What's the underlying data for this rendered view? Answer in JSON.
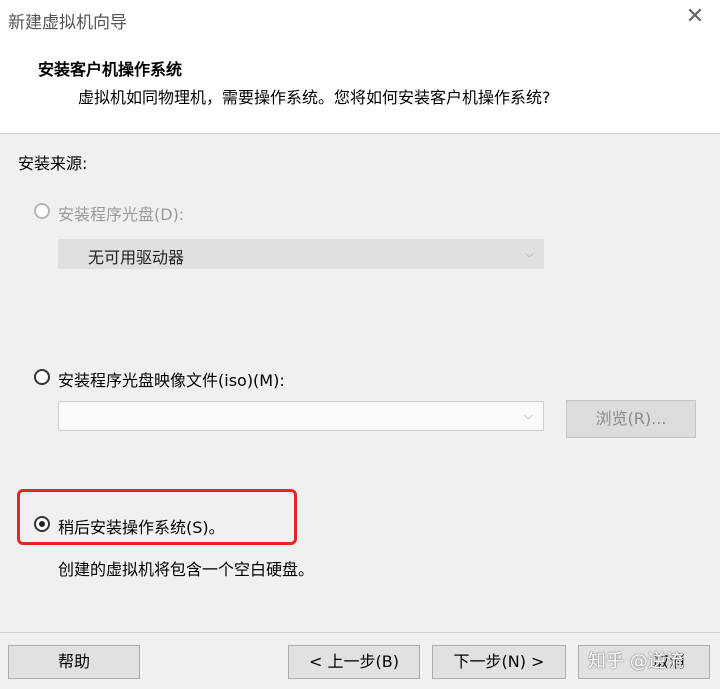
{
  "window": {
    "title": "新建虚拟机向导",
    "close_glyph": "✕"
  },
  "header": {
    "title": "安装客户机操作系统",
    "subtitle": "虚拟机如同物理机，需要操作系统。您将如何安装客户机操作系统?"
  },
  "source_label": "安装来源:",
  "options": {
    "disc": {
      "label": "安装程序光盘(D):",
      "selected": false,
      "enabled": false,
      "dropdown_value": "无可用驱动器"
    },
    "iso": {
      "label": "安装程序光盘映像文件(iso)(M):",
      "selected": false,
      "enabled": true,
      "dropdown_value": "",
      "browse_label": "浏览(R)..."
    },
    "later": {
      "label": "稍后安装操作系统(S)。",
      "selected": true,
      "enabled": true,
      "description": "创建的虚拟机将包含一个空白硬盘。"
    }
  },
  "footer": {
    "help_label": "帮助",
    "back_label": "< 上一步(B)",
    "next_label": "下一步(N) >",
    "cancel_label": "取消"
  },
  "watermark": "知乎 @逆流",
  "colors": {
    "highlight": "#e32727",
    "window_bg": "#f0f0f0",
    "header_bg": "#ffffff"
  }
}
